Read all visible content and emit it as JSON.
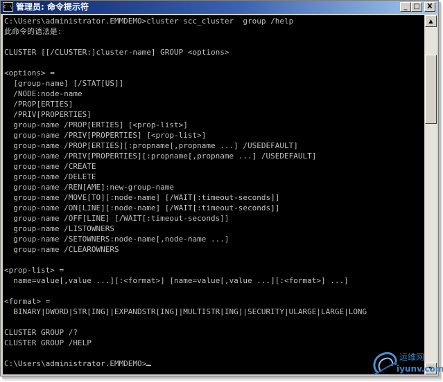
{
  "window": {
    "title": "管理员: 命令提示符",
    "icon_text": "C:\\",
    "minimize_symbol": "_",
    "maximize_symbol": "□",
    "close_symbol": "X"
  },
  "console": {
    "lines": [
      "C:\\Users\\administrator.EMMDEMO>cluster scc_cluster  group /help",
      "此命令的语法是:",
      "",
      "CLUSTER [[/CLUSTER:]cluster-name] GROUP <options>",
      "",
      "<options> =",
      "  [group-name] [/STAT[US]]",
      "  /NODE:node-name",
      "  /PROP[ERTIES]",
      "  /PRIV[PROPERTIES]",
      "  group-name /PROP[ERTIES] [<prop-list>]",
      "  group-name /PRIV[PROPERTIES] [<prop-list>]",
      "  group-name /PROP[ERTIES][:propname[,propname ...] /USEDEFAULT]",
      "  group-name /PRIV[PROPERTIES][:propname[,propname ...] /USEDEFAULT]",
      "  group-name /CREATE",
      "  group-name /DELETE",
      "  group-name /REN[AME]:new-group-name",
      "  group-name /MOVE[TO][:node-name] [/WAIT[:timeout-seconds]]",
      "  group-name /ON[LINE][:node-name] [/WAIT[:timeout-seconds]]",
      "  group-name /OFF[LINE] [/WAIT[:timeout-seconds]]",
      "  group-name /LISTOWNERS",
      "  group-name /SETOWNERS:node-name[,node-name ...]",
      "  group-name /CLEAROWNERS",
      "",
      "<prop-list> =",
      "  name=value[,value ...][:<format>] [name=value[,value ...][:<format>] ...]",
      "",
      "<format> =",
      "  BINARY|DWORD|STR[ING]|EXPANDSTR[ING]|MULTISTR[ING]|SECURITY|ULARGE|LARGE|LONG",
      "",
      "CLUSTER GROUP /?",
      "CLUSTER GROUP /HELP",
      "",
      "C:\\Users\\administrator.EMMDEMO>"
    ]
  },
  "scrollbar": {
    "up_symbol": "▲",
    "down_symbol": "▼"
  },
  "watermark": {
    "text_cn": "运维网",
    "text_en": "iyunv.com"
  }
}
